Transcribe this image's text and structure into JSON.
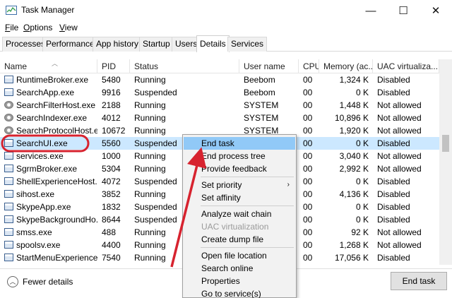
{
  "window": {
    "title": "Task Manager",
    "min_glyph": "—",
    "max_glyph": "☐",
    "close_glyph": "✕"
  },
  "menu": [
    {
      "first": "F",
      "rest": "ile"
    },
    {
      "first": "O",
      "rest": "ptions"
    },
    {
      "first": "V",
      "rest": "iew"
    }
  ],
  "tabs": [
    "Processes",
    "Performance",
    "App history",
    "Startup",
    "Users",
    "Details",
    "Services"
  ],
  "active_tab": "Details",
  "columns": [
    "Name",
    "PID",
    "Status",
    "User name",
    "CPU",
    "Memory (ac...",
    "UAC virtualiza..."
  ],
  "rows": [
    {
      "name": "RuntimeBroker.exe",
      "pid": "5480",
      "status": "Running",
      "user": "Beebom",
      "cpu": "00",
      "memory": "1,324 K",
      "uac": "Disabled",
      "icon": "window-icon"
    },
    {
      "name": "SearchApp.exe",
      "pid": "9916",
      "status": "Suspended",
      "user": "Beebom",
      "cpu": "00",
      "memory": "0 K",
      "uac": "Disabled",
      "icon": "window-icon"
    },
    {
      "name": "SearchFilterHost.exe",
      "pid": "2188",
      "status": "Running",
      "user": "SYSTEM",
      "cpu": "00",
      "memory": "1,448 K",
      "uac": "Not allowed",
      "icon": "gear-icon"
    },
    {
      "name": "SearchIndexer.exe",
      "pid": "4012",
      "status": "Running",
      "user": "SYSTEM",
      "cpu": "00",
      "memory": "10,896 K",
      "uac": "Not allowed",
      "icon": "gear-icon"
    },
    {
      "name": "SearchProtocolHost.e...",
      "pid": "10672",
      "status": "Running",
      "user": "SYSTEM",
      "cpu": "00",
      "memory": "1,920 K",
      "uac": "Not allowed",
      "icon": "gear-icon"
    },
    {
      "name": "SearchUI.exe",
      "pid": "5560",
      "status": "Suspended",
      "user": "",
      "cpu": "00",
      "memory": "0 K",
      "uac": "Disabled",
      "icon": "window-icon"
    },
    {
      "name": "services.exe",
      "pid": "1000",
      "status": "Running",
      "user": "",
      "cpu": "00",
      "memory": "3,040 K",
      "uac": "Not allowed",
      "icon": "window-icon"
    },
    {
      "name": "SgrmBroker.exe",
      "pid": "5304",
      "status": "Running",
      "user": "",
      "cpu": "00",
      "memory": "2,992 K",
      "uac": "Not allowed",
      "icon": "window-icon"
    },
    {
      "name": "ShellExperienceHost...",
      "pid": "4072",
      "status": "Suspended",
      "user": "",
      "cpu": "00",
      "memory": "0 K",
      "uac": "Disabled",
      "icon": "window-icon"
    },
    {
      "name": "sihost.exe",
      "pid": "3852",
      "status": "Running",
      "user": "",
      "cpu": "00",
      "memory": "4,136 K",
      "uac": "Disabled",
      "icon": "window-icon"
    },
    {
      "name": "SkypeApp.exe",
      "pid": "1832",
      "status": "Suspended",
      "user": "",
      "cpu": "00",
      "memory": "0 K",
      "uac": "Disabled",
      "icon": "window-icon"
    },
    {
      "name": "SkypeBackgroundHo...",
      "pid": "8644",
      "status": "Suspended",
      "user": "",
      "cpu": "00",
      "memory": "0 K",
      "uac": "Disabled",
      "icon": "window-icon"
    },
    {
      "name": "smss.exe",
      "pid": "488",
      "status": "Running",
      "user": "",
      "cpu": "00",
      "memory": "92 K",
      "uac": "Not allowed",
      "icon": "window-icon"
    },
    {
      "name": "spoolsv.exe",
      "pid": "4400",
      "status": "Running",
      "user": "",
      "cpu": "00",
      "memory": "1,268 K",
      "uac": "Not allowed",
      "icon": "printer-icon"
    },
    {
      "name": "StartMenuExperience...",
      "pid": "7540",
      "status": "Running",
      "user": "",
      "cpu": "00",
      "memory": "17,056 K",
      "uac": "Disabled",
      "icon": "window-icon"
    }
  ],
  "selected_row": 5,
  "context_menu": [
    {
      "label": "End task",
      "highlight": true
    },
    {
      "label": "End process tree"
    },
    {
      "label": "Provide feedback"
    },
    {
      "sep": true
    },
    {
      "label": "Set priority",
      "submenu": true
    },
    {
      "label": "Set affinity"
    },
    {
      "sep": true
    },
    {
      "label": "Analyze wait chain"
    },
    {
      "label": "UAC virtualization",
      "disabled": true
    },
    {
      "label": "Create dump file"
    },
    {
      "sep": true
    },
    {
      "label": "Open file location"
    },
    {
      "label": "Search online"
    },
    {
      "label": "Properties"
    },
    {
      "label": "Go to service(s)"
    }
  ],
  "footer": {
    "fewer_details": "Fewer details",
    "end_task": "End task"
  },
  "colors": {
    "selection": "#cce8ff",
    "menu_highlight": "#91c9f7",
    "annotation": "#d7232f"
  }
}
